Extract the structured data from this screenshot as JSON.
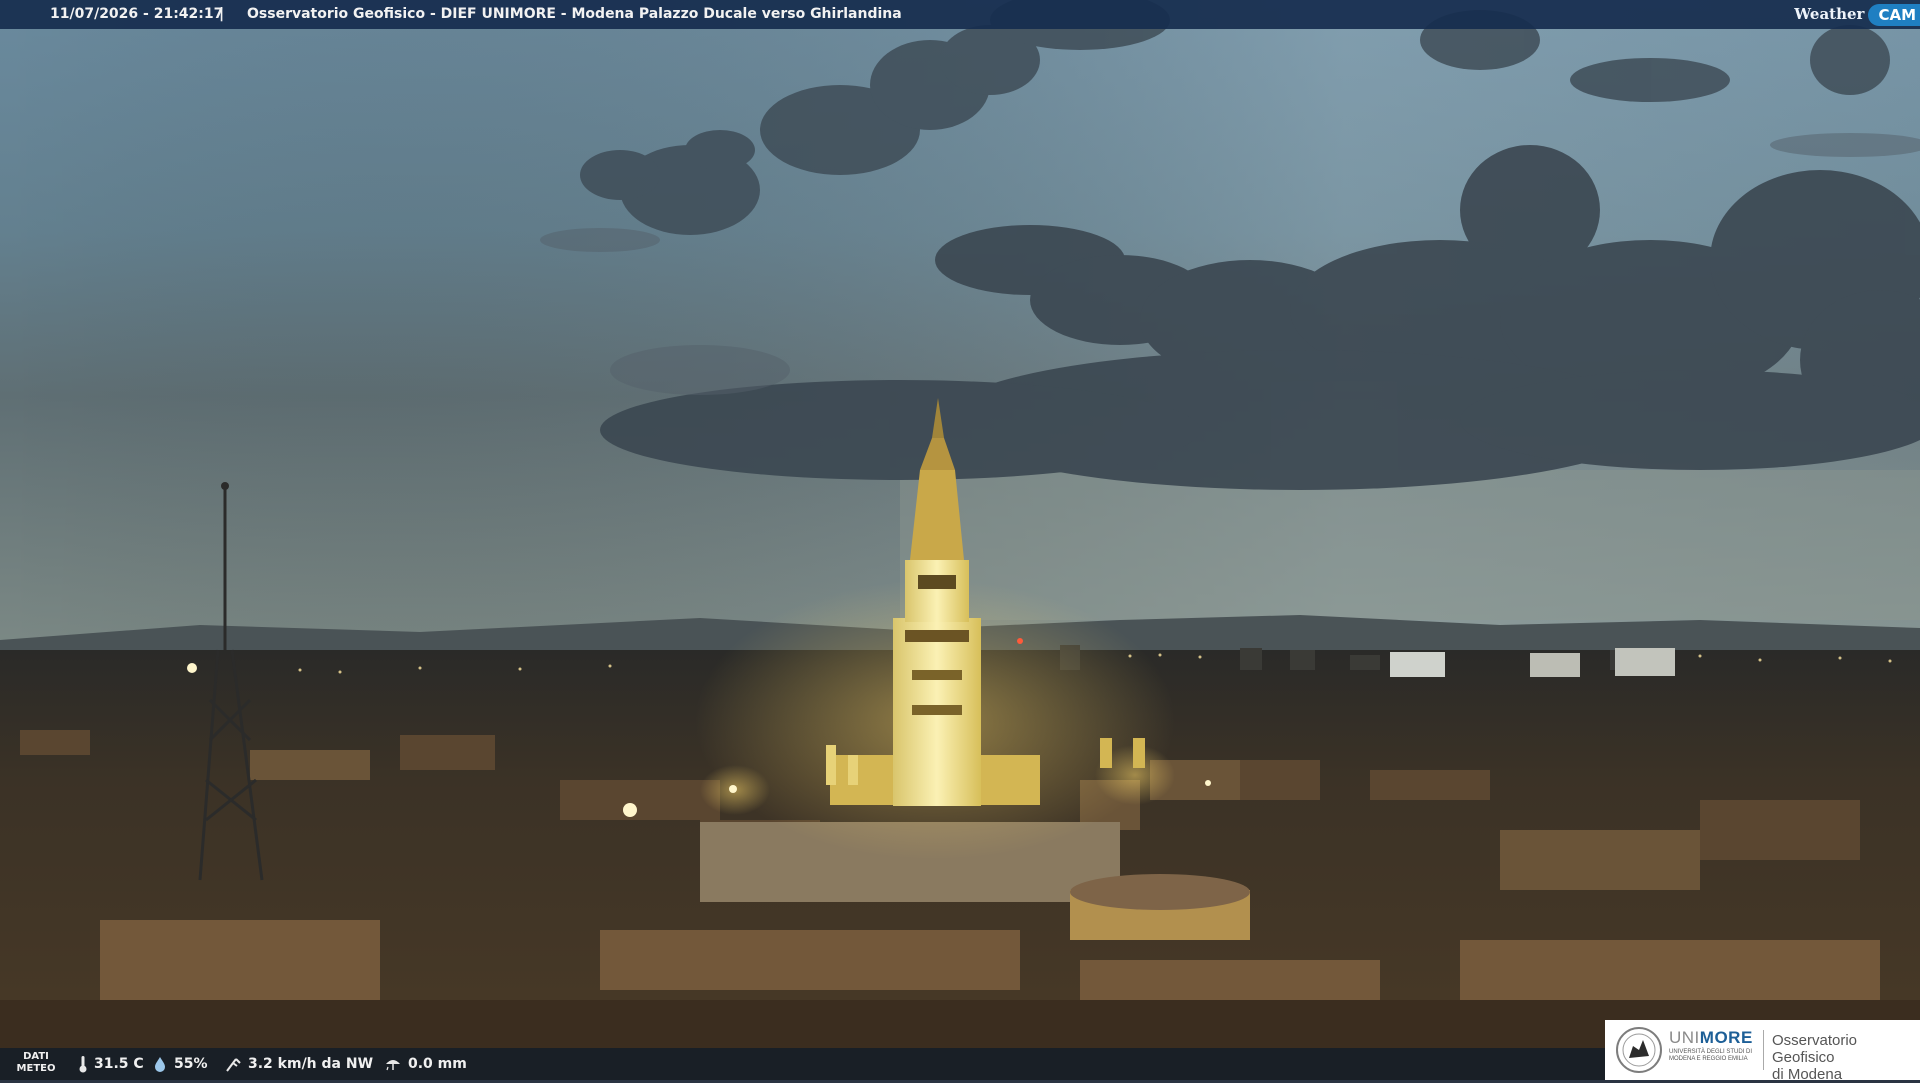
{
  "caption": {
    "timestamp": "11/07/2026 - 21:42:17",
    "separator": "|",
    "title": "Osservatorio Geofisico - DIEF UNIMORE - Modena Palazzo Ducale verso Ghirlandina"
  },
  "logo": {
    "weather": "Weather",
    "cam": "CAM"
  },
  "weather": {
    "section_label_1": "DATI",
    "section_label_2": "METEO",
    "temperature": "31.5 C",
    "humidity": "55%",
    "wind": "3.2 km/h da NW",
    "rain": "0.0 mm",
    "icons": [
      "thermometer-icon",
      "humidity-drop-icon",
      "wind-icon",
      "rain-icon"
    ]
  },
  "university": {
    "brand_light": "UNI",
    "brand_bold": "MORE",
    "subtitle": "UNIVERSITÀ DEGLI STUDI DI MODENA E REGGIO EMILIA",
    "observatory_line1": "Osservatorio Geofisico",
    "observatory_line2": "di Modena"
  },
  "colors": {
    "sky_top": "#6d8ca0",
    "sky_horizon": "#9fb0ad",
    "tower_light": "#f3e7a3",
    "city_dark": "#3a2f22",
    "caption_bar": "#162c4e",
    "cam_badge": "#1f7fc2",
    "unimore_blue": "#1d5f97"
  }
}
